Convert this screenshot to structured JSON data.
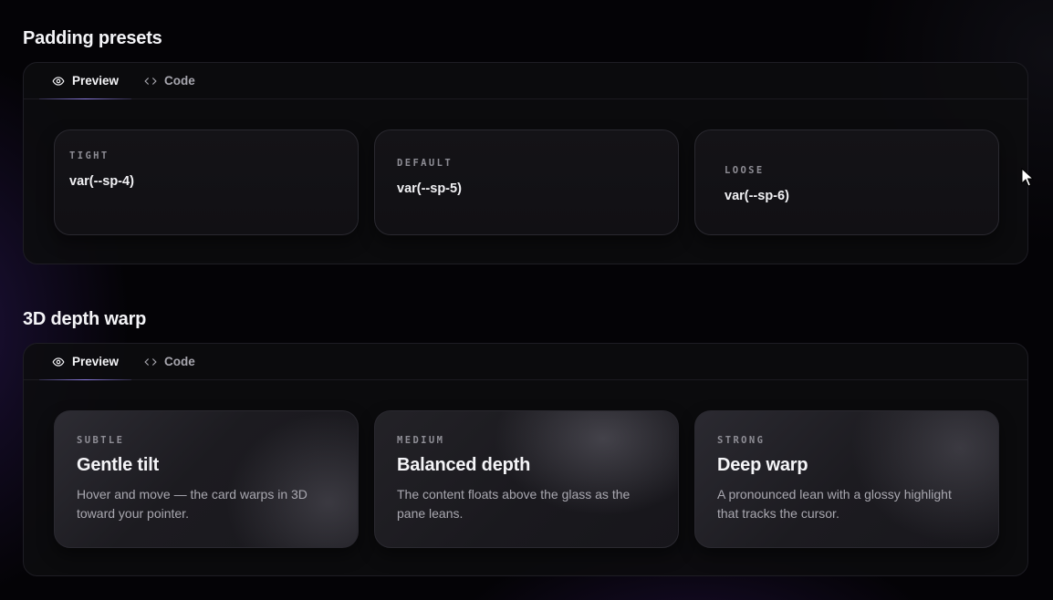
{
  "sections": [
    {
      "title": "Padding presets",
      "tabs": [
        {
          "label": "Preview",
          "icon": "eye-icon"
        },
        {
          "label": "Code",
          "icon": "code-icon"
        }
      ],
      "active_tab": "Preview",
      "cards": [
        {
          "label": "TIGHT",
          "value": "var(--sp-4)"
        },
        {
          "label": "DEFAULT",
          "value": "var(--sp-5)"
        },
        {
          "label": "LOOSE",
          "value": "var(--sp-6)"
        }
      ]
    },
    {
      "title": "3D depth warp",
      "tabs": [
        {
          "label": "Preview",
          "icon": "eye-icon"
        },
        {
          "label": "Code",
          "icon": "code-icon"
        }
      ],
      "active_tab": "Preview",
      "cards": [
        {
          "label": "SUBTLE",
          "title": "Gentle tilt",
          "desc": "Hover and move — the card warps in 3D toward your pointer."
        },
        {
          "label": "MEDIUM",
          "title": "Balanced depth",
          "desc": "The content floats above the glass as the pane leans."
        },
        {
          "label": "STRONG",
          "title": "Deep warp",
          "desc": "A pronounced lean with a glossy highlight that tracks the cursor."
        }
      ]
    }
  ],
  "colors": {
    "accent": "#8f7ee6",
    "background": "#040306",
    "panel": "#0c0c0f"
  }
}
